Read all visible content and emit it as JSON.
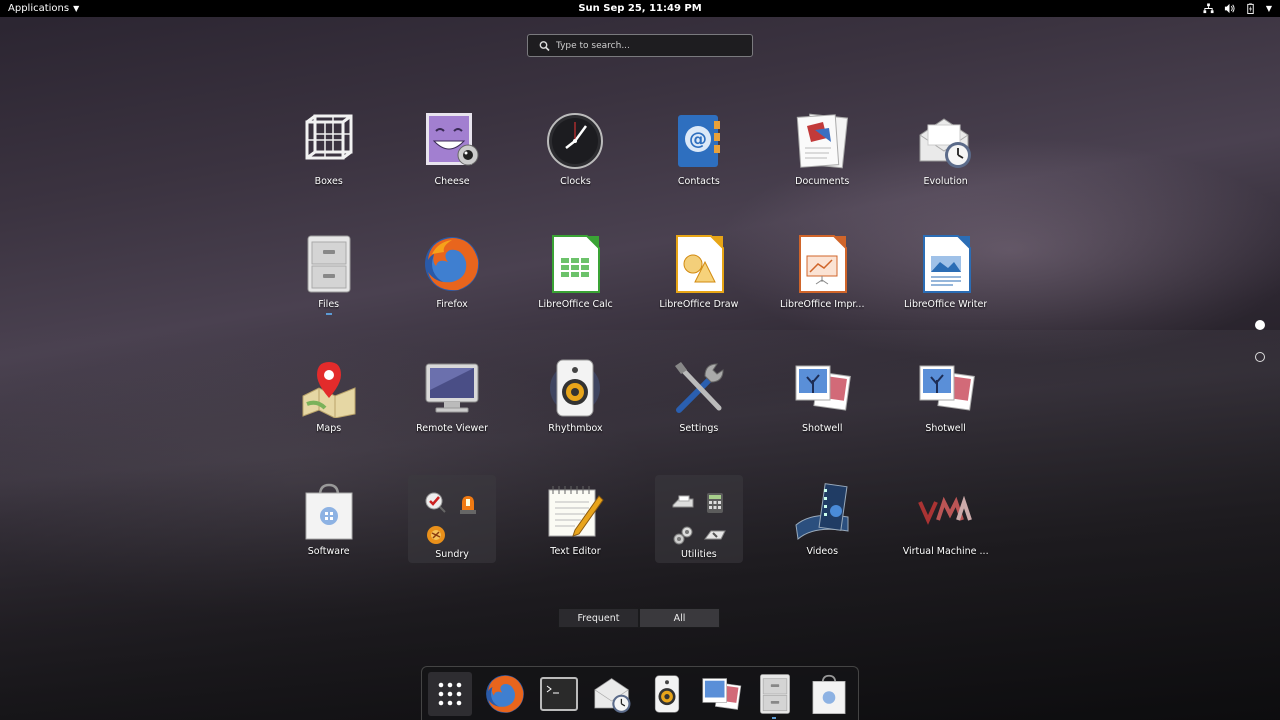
{
  "topbar": {
    "activities_label": "Applications",
    "clock": "Sun Sep 25, 11:49 PM",
    "tray_icons": [
      "network-icon",
      "volume-icon",
      "battery-icon",
      "system-menu-caret"
    ]
  },
  "search": {
    "placeholder": "Type to search..."
  },
  "apps": [
    {
      "label": "Boxes",
      "icon": "boxes-icon"
    },
    {
      "label": "Cheese",
      "icon": "cheese-icon"
    },
    {
      "label": "Clocks",
      "icon": "clocks-icon"
    },
    {
      "label": "Contacts",
      "icon": "contacts-icon"
    },
    {
      "label": "Documents",
      "icon": "documents-icon"
    },
    {
      "label": "Evolution",
      "icon": "evolution-icon"
    },
    {
      "label": "Files",
      "icon": "files-icon",
      "running": true
    },
    {
      "label": "Firefox",
      "icon": "firefox-icon"
    },
    {
      "label": "LibreOffice Calc",
      "icon": "calc-icon"
    },
    {
      "label": "LibreOffice Draw",
      "icon": "draw-icon"
    },
    {
      "label": "LibreOffice Impr...",
      "icon": "impress-icon"
    },
    {
      "label": "LibreOffice Writer",
      "icon": "writer-icon"
    },
    {
      "label": "Maps",
      "icon": "maps-icon"
    },
    {
      "label": "Remote Viewer",
      "icon": "remote-viewer-icon"
    },
    {
      "label": "Rhythmbox",
      "icon": "rhythmbox-icon"
    },
    {
      "label": "Settings",
      "icon": "settings-icon"
    },
    {
      "label": "Shotwell",
      "icon": "shotwell-icon"
    },
    {
      "label": "Shotwell",
      "icon": "shotwell-icon"
    },
    {
      "label": "Software",
      "icon": "software-icon"
    },
    {
      "label": "Sundry",
      "icon": "folder",
      "folder": true
    },
    {
      "label": "Text Editor",
      "icon": "text-editor-icon"
    },
    {
      "label": "Utilities",
      "icon": "folder",
      "folder": true
    },
    {
      "label": "Videos",
      "icon": "videos-icon"
    },
    {
      "label": "Virtual Machine ...",
      "icon": "virt-manager-icon"
    }
  ],
  "view_switcher": {
    "frequent": "Frequent",
    "all": "All",
    "active": "all"
  },
  "pager": {
    "pages": 2,
    "current": 1
  },
  "dock": {
    "items": [
      "show-apps",
      "firefox",
      "terminal",
      "evolution",
      "rhythmbox",
      "shotwell",
      "files",
      "software"
    ],
    "running": [
      "files"
    ]
  },
  "colors": {
    "accent": "#5b9bd5",
    "topbar": "#000000"
  }
}
